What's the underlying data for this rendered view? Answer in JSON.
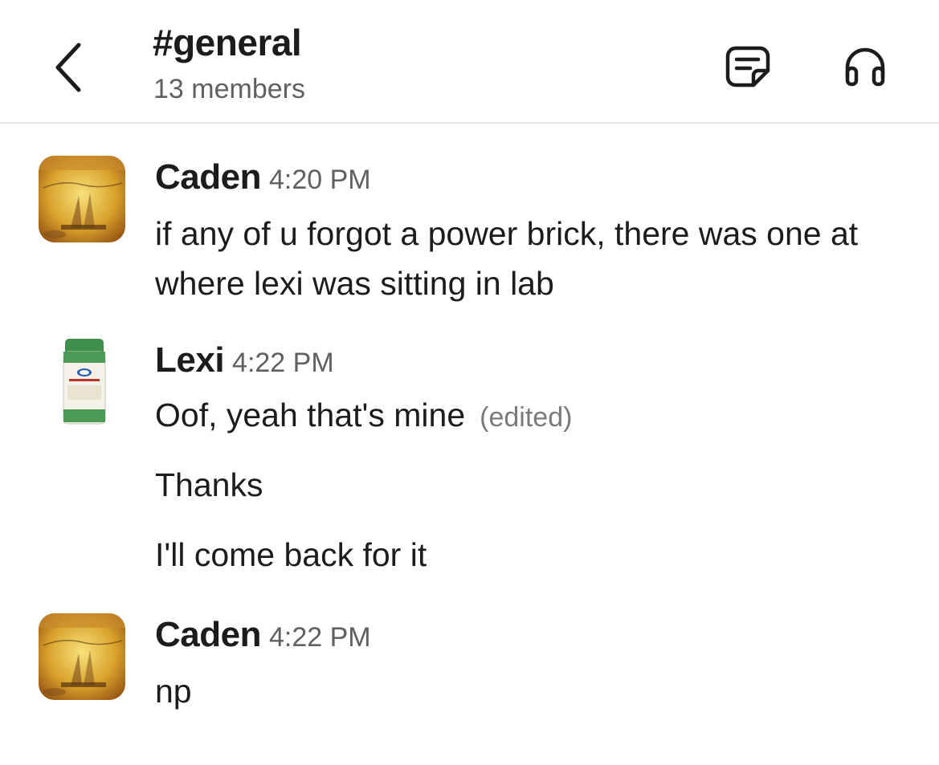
{
  "header": {
    "channel_name": "#general",
    "member_count": "13 members",
    "icons": [
      "chevron-left-icon",
      "canvas-notes-icon",
      "headphones-icon"
    ]
  },
  "messages": [
    {
      "sender": "Caden",
      "time": "4:20 PM",
      "avatar": "album-cover-avatar",
      "lines": [
        "if any of u forgot a power brick, there was one at where lexi was sitting in lab"
      ]
    },
    {
      "sender": "Lexi",
      "time": "4:22 PM",
      "avatar": "parmesan-cheese-avatar",
      "lines": [
        "Oof, yeah that's mine",
        "Thanks",
        "I'll come back for it"
      ],
      "edited_label": "(edited)"
    },
    {
      "sender": "Caden",
      "time": "4:22 PM",
      "avatar": "album-cover-avatar",
      "lines": [
        "np"
      ]
    }
  ],
  "colors": {
    "text": "#1d1c1d",
    "muted": "#616061",
    "divider": "#e6e6e6"
  }
}
